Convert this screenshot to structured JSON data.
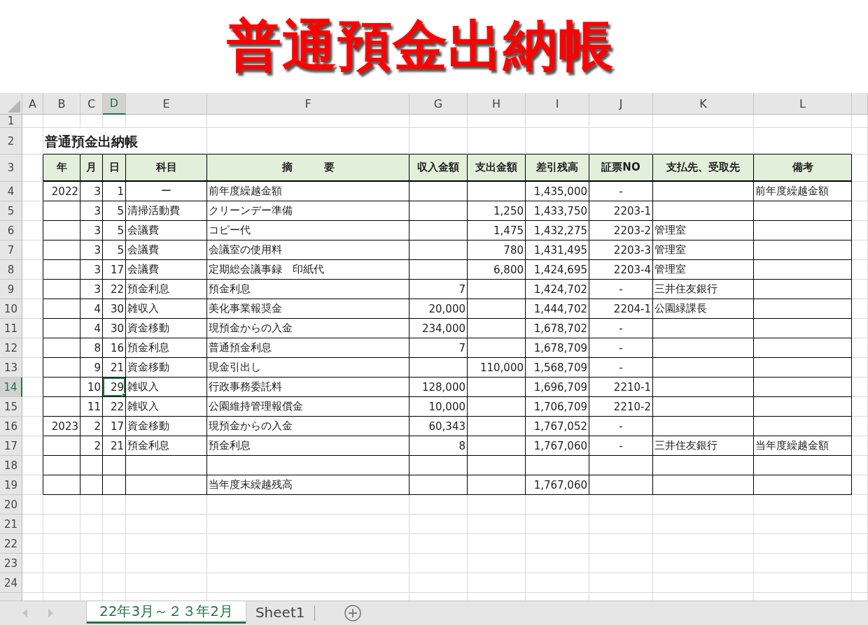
{
  "title": "普通預金出納帳",
  "column_headers": [
    {
      "label": "A",
      "selected": false
    },
    {
      "label": "B",
      "selected": false
    },
    {
      "label": "C",
      "selected": false
    },
    {
      "label": "D",
      "selected": true
    },
    {
      "label": "E",
      "selected": false
    },
    {
      "label": "F",
      "selected": false
    },
    {
      "label": "G",
      "selected": false
    },
    {
      "label": "H",
      "selected": false
    },
    {
      "label": "I",
      "selected": false
    },
    {
      "label": "J",
      "selected": false
    },
    {
      "label": "K",
      "selected": false
    },
    {
      "label": "L",
      "selected": false
    }
  ],
  "row_numbers": [
    {
      "label": "1",
      "selected": false
    },
    {
      "label": "2",
      "selected": false
    },
    {
      "label": "3",
      "selected": false
    },
    {
      "label": "4",
      "selected": false
    },
    {
      "label": "5",
      "selected": false
    },
    {
      "label": "6",
      "selected": false
    },
    {
      "label": "7",
      "selected": false
    },
    {
      "label": "8",
      "selected": false
    },
    {
      "label": "9",
      "selected": false
    },
    {
      "label": "10",
      "selected": false
    },
    {
      "label": "11",
      "selected": false
    },
    {
      "label": "12",
      "selected": false
    },
    {
      "label": "13",
      "selected": false
    },
    {
      "label": "14",
      "selected": true
    },
    {
      "label": "15",
      "selected": false
    },
    {
      "label": "16",
      "selected": false
    },
    {
      "label": "17",
      "selected": false
    },
    {
      "label": "18",
      "selected": false
    },
    {
      "label": "19",
      "selected": false
    },
    {
      "label": "20",
      "selected": false
    },
    {
      "label": "21",
      "selected": false
    },
    {
      "label": "22",
      "selected": false
    },
    {
      "label": "23",
      "selected": false
    },
    {
      "label": "24",
      "selected": false
    }
  ],
  "sheet_title": "普通預金出納帳",
  "table": {
    "columns": [
      "年",
      "月",
      "日",
      "科目",
      "摘　　　要",
      "収入金額",
      "支出金額",
      "差引残高",
      "証票NO",
      "支払先、受取先",
      "備考"
    ],
    "rows": [
      [
        "2022",
        "3",
        "1",
        "ー",
        "前年度繰越金額",
        null,
        null,
        "1,435,000",
        "-",
        null,
        "前年度繰越金額"
      ],
      [
        null,
        "3",
        "5",
        "清掃活動費",
        "クリーンデー準備",
        null,
        "1,250",
        "1,433,750",
        "2203-1",
        null,
        null
      ],
      [
        null,
        "3",
        "5",
        "会議費",
        "コピー代",
        null,
        "1,475",
        "1,432,275",
        "2203-2",
        "管理室",
        null
      ],
      [
        null,
        "3",
        "5",
        "会議費",
        "会議室の使用料",
        null,
        "780",
        "1,431,495",
        "2203-3",
        "管理室",
        null
      ],
      [
        null,
        "3",
        "17",
        "会議費",
        "定期総会議事録　印紙代",
        null,
        "6,800",
        "1,424,695",
        "2203-4",
        "管理室",
        null
      ],
      [
        null,
        "3",
        "22",
        "預金利息",
        "預金利息",
        "7",
        null,
        "1,424,702",
        "-",
        "三井住友銀行",
        null
      ],
      [
        null,
        "4",
        "30",
        "雑収入",
        "美化事業報奨金",
        "20,000",
        null,
        "1,444,702",
        "2204-1",
        "公園緑課長",
        null
      ],
      [
        null,
        "4",
        "30",
        "資金移動",
        "現預金からの入金",
        "234,000",
        null,
        "1,678,702",
        "-",
        null,
        null
      ],
      [
        null,
        "8",
        "16",
        "預金利息",
        "普通預金利息",
        "7",
        null,
        "1,678,709",
        "-",
        null,
        null
      ],
      [
        null,
        "9",
        "21",
        "資金移動",
        "現金引出し",
        null,
        "110,000",
        "1,568,709",
        "-",
        null,
        null
      ],
      [
        null,
        "10",
        "29",
        "雑収入",
        "行政事務委託料",
        "128,000",
        null,
        "1,696,709",
        "2210-1",
        null,
        null
      ],
      [
        null,
        "11",
        "22",
        "雑収入",
        "公園維持管理報償金",
        "10,000",
        null,
        "1,706,709",
        "2210-2",
        null,
        null
      ],
      [
        "2023",
        "2",
        "17",
        "資金移動",
        "現預金からの入金",
        "60,343",
        null,
        "1,767,052",
        "-",
        null,
        null
      ],
      [
        null,
        "2",
        "21",
        "預金利息",
        "預金利息",
        "8",
        null,
        "1,767,060",
        "-",
        "三井住友銀行",
        "当年度繰越金額"
      ],
      [
        null,
        null,
        null,
        null,
        null,
        null,
        null,
        null,
        null,
        null,
        null
      ],
      [
        null,
        null,
        null,
        null,
        "当年度末繰越残高",
        null,
        null,
        "1,767,060",
        null,
        null,
        null
      ]
    ]
  },
  "sheet_tabs": [
    {
      "label": "22年3月～２３年2月",
      "selected": true
    },
    {
      "label": "Sheet1",
      "selected": false
    }
  ]
}
